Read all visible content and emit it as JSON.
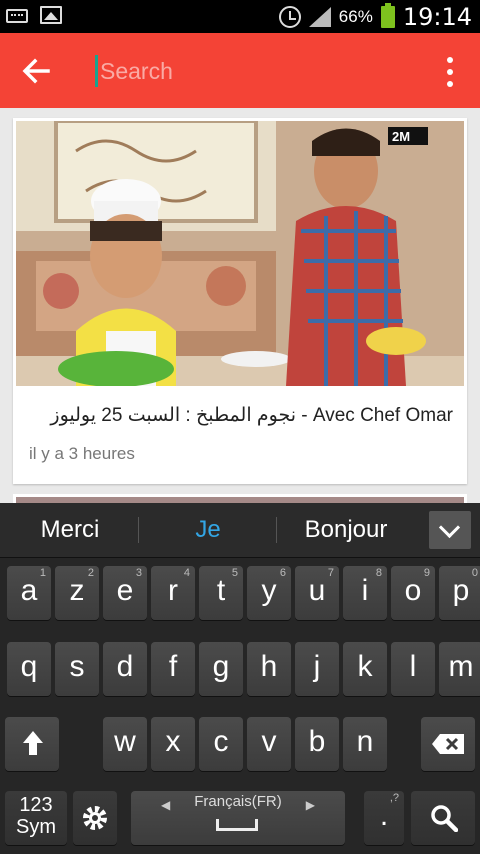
{
  "status_bar": {
    "battery": "66%",
    "time": "19:14",
    "icons": [
      "keyboard-icon",
      "image-icon",
      "alarm-icon",
      "signal-icon",
      "battery-icon"
    ]
  },
  "toolbar": {
    "search_placeholder": "Search",
    "back_icon": "arrow-back-icon",
    "overflow_icon": "more-vert-icon",
    "color": "#f44336"
  },
  "video": {
    "title": "نجوم المطبخ : السبت 25 يوليوز - Avec Chef Omar",
    "time": "il y a 3 heures",
    "channel_logo_text": "2M"
  },
  "keyboard": {
    "suggestions": [
      "Merci",
      "Je",
      "Bonjour"
    ],
    "row1": [
      {
        "k": "a",
        "h": "1"
      },
      {
        "k": "z",
        "h": "2"
      },
      {
        "k": "e",
        "h": "3"
      },
      {
        "k": "r",
        "h": "4"
      },
      {
        "k": "t",
        "h": "5"
      },
      {
        "k": "y",
        "h": "6"
      },
      {
        "k": "u",
        "h": "7"
      },
      {
        "k": "i",
        "h": "8"
      },
      {
        "k": "o",
        "h": "9"
      },
      {
        "k": "p",
        "h": "0"
      }
    ],
    "row2": [
      "q",
      "s",
      "d",
      "f",
      "g",
      "h",
      "j",
      "k",
      "l",
      "m"
    ],
    "row3": [
      "w",
      "x",
      "c",
      "v",
      "b",
      "n"
    ],
    "sym_top": "123",
    "sym_bottom": "Sym",
    "language": "Français(FR)",
    "period": ".",
    "period_hint": ",?"
  }
}
